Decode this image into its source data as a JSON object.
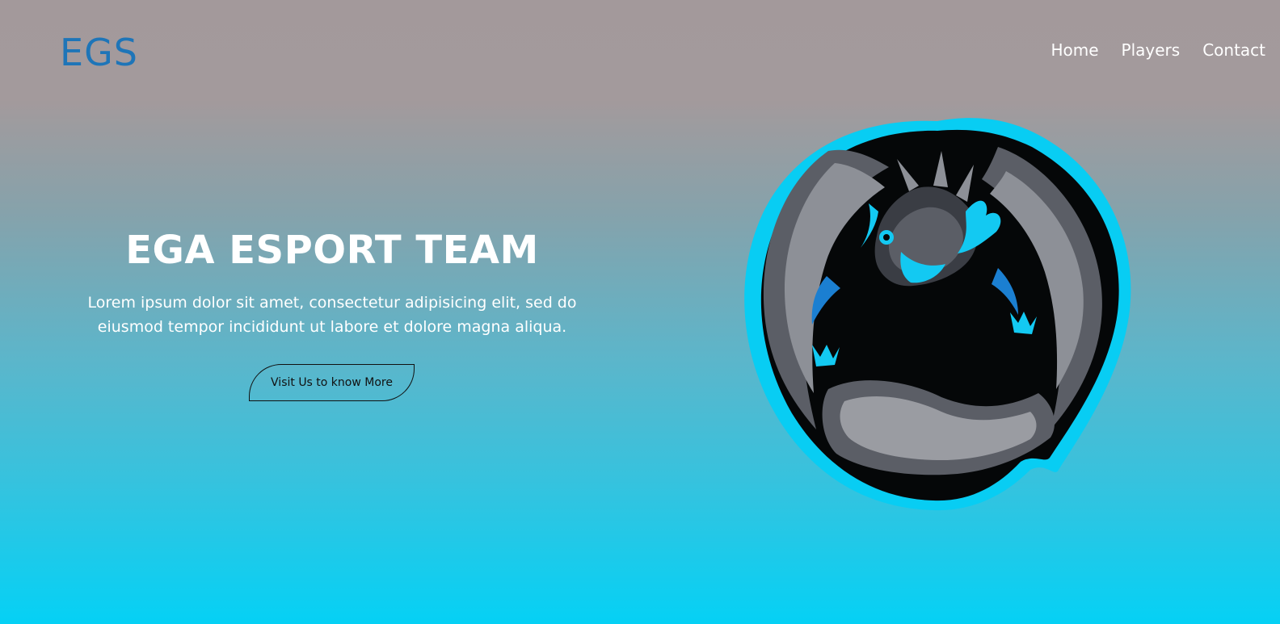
{
  "brand": {
    "logo_text": "EGS"
  },
  "nav": {
    "items": [
      {
        "label": "Home"
      },
      {
        "label": "Players"
      },
      {
        "label": "Contact"
      }
    ]
  },
  "hero": {
    "title": "EGA ESPORT TEAM",
    "description": "Lorem ipsum dolor sit amet, consectetur adipisicing elit, sed do eiusmod tempor incididunt ut labore et dolore magna aliqua.",
    "cta_label": "Visit Us to know More"
  },
  "emblem": {
    "icon": "dragon-mascot-icon"
  },
  "colors": {
    "accent": "#1e75b8",
    "cyan": "#00d2f5",
    "gradient_top": "#a3999b",
    "gradient_bottom": "#05d1f5"
  }
}
